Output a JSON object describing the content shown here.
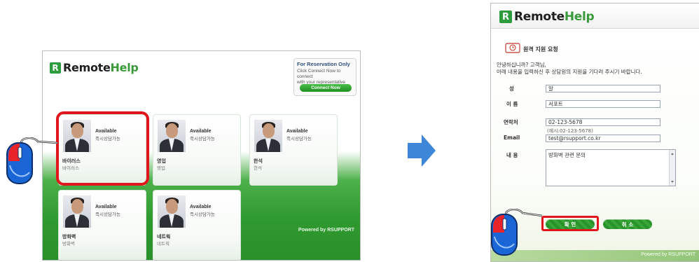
{
  "left": {
    "logo": {
      "mark": "R",
      "remote": "Remote",
      "help": "Help"
    },
    "reservation": {
      "title": "For Reservation Only",
      "desc_line1": "Click Connect Now to connect",
      "desc_line2": "with your representative",
      "button": "Connect Now"
    },
    "agents": [
      {
        "status_en": "Available",
        "status_ko": "즉시상담가능",
        "name": "바이러스",
        "sub": "바이러스"
      },
      {
        "status_en": "Available",
        "status_ko": "즉시상담가능",
        "name": "영업",
        "sub": "영업"
      },
      {
        "status_en": "Available",
        "status_ko": "즉시상담가능",
        "name": "한석",
        "sub": "한석"
      },
      {
        "status_en": "Available",
        "status_ko": "즉시상담가능",
        "name": "방화벽",
        "sub": "방화벽"
      },
      {
        "status_en": "Available",
        "status_ko": "즉시상담가능",
        "name": "네트웍",
        "sub": "네트웍"
      }
    ],
    "powered": "Powered by RSUPPORT"
  },
  "right": {
    "logo": {
      "mark": "R",
      "remote": "Remote",
      "help": "Help"
    },
    "title": "원격 지원 요청",
    "greeting_line1": "안녕하십니까? 고객님,",
    "greeting_line2": "아래 내용을 입력하신 후 상담원의 지원을 기다려 주시기 바랍니다.",
    "form": {
      "surname_label": "성",
      "surname_value": "알",
      "name_label": "이 름",
      "name_value": "서포트",
      "phone_label": "연락처",
      "phone_value": "02-123-5678",
      "phone_hint": "(예시:02-123-5678)",
      "email_label": "Email",
      "email_value": "test@rsupport.co.kr",
      "content_label": "내 용",
      "content_value": "방화벽 관련 문의"
    },
    "confirm_button": "확 인",
    "cancel_button": "취 소",
    "powered": "Powered by RSUPPORT"
  },
  "colors": {
    "brand_green": "#2e9c3d",
    "highlight_red": "#e0161c",
    "arrow_blue": "#3d86d8"
  },
  "icons": [
    "mouse-icon",
    "arrow-right-icon",
    "calendar-icon",
    "logo-mark-icon"
  ]
}
